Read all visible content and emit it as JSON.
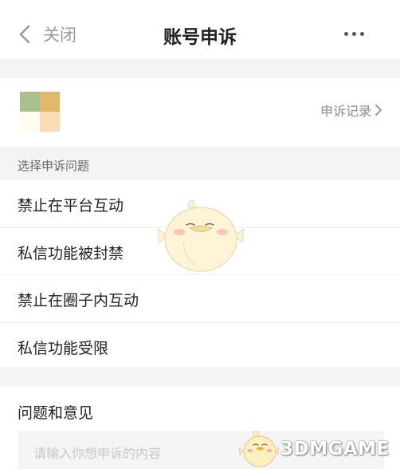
{
  "header": {
    "back_label": "关闭",
    "title": "账号申诉",
    "icons": {
      "back": "chevron-left-icon",
      "more": "more-dots-icon"
    }
  },
  "account": {
    "records_label": "申诉记录",
    "records_icon": "chevron-right-icon",
    "avatar_colors": [
      "#a9c08a",
      "#e0b96a",
      "#fefbf1",
      "#f8dcb3"
    ]
  },
  "section": {
    "title": "选择申诉问题"
  },
  "options": [
    {
      "label": "禁止在平台互动"
    },
    {
      "label": "私信功能被封禁"
    },
    {
      "label": "禁止在圈子内互动"
    },
    {
      "label": "私信功能受限"
    }
  ],
  "feedback": {
    "label": "问题和意见",
    "value": "",
    "placeholder": "请输入你想申诉的内容"
  },
  "watermark": {
    "text": "3DMGAME"
  },
  "colors": {
    "background": "#ffffff",
    "divider": "#f4f4f4",
    "text_primary": "#222222",
    "text_secondary": "#8e8e8e"
  }
}
